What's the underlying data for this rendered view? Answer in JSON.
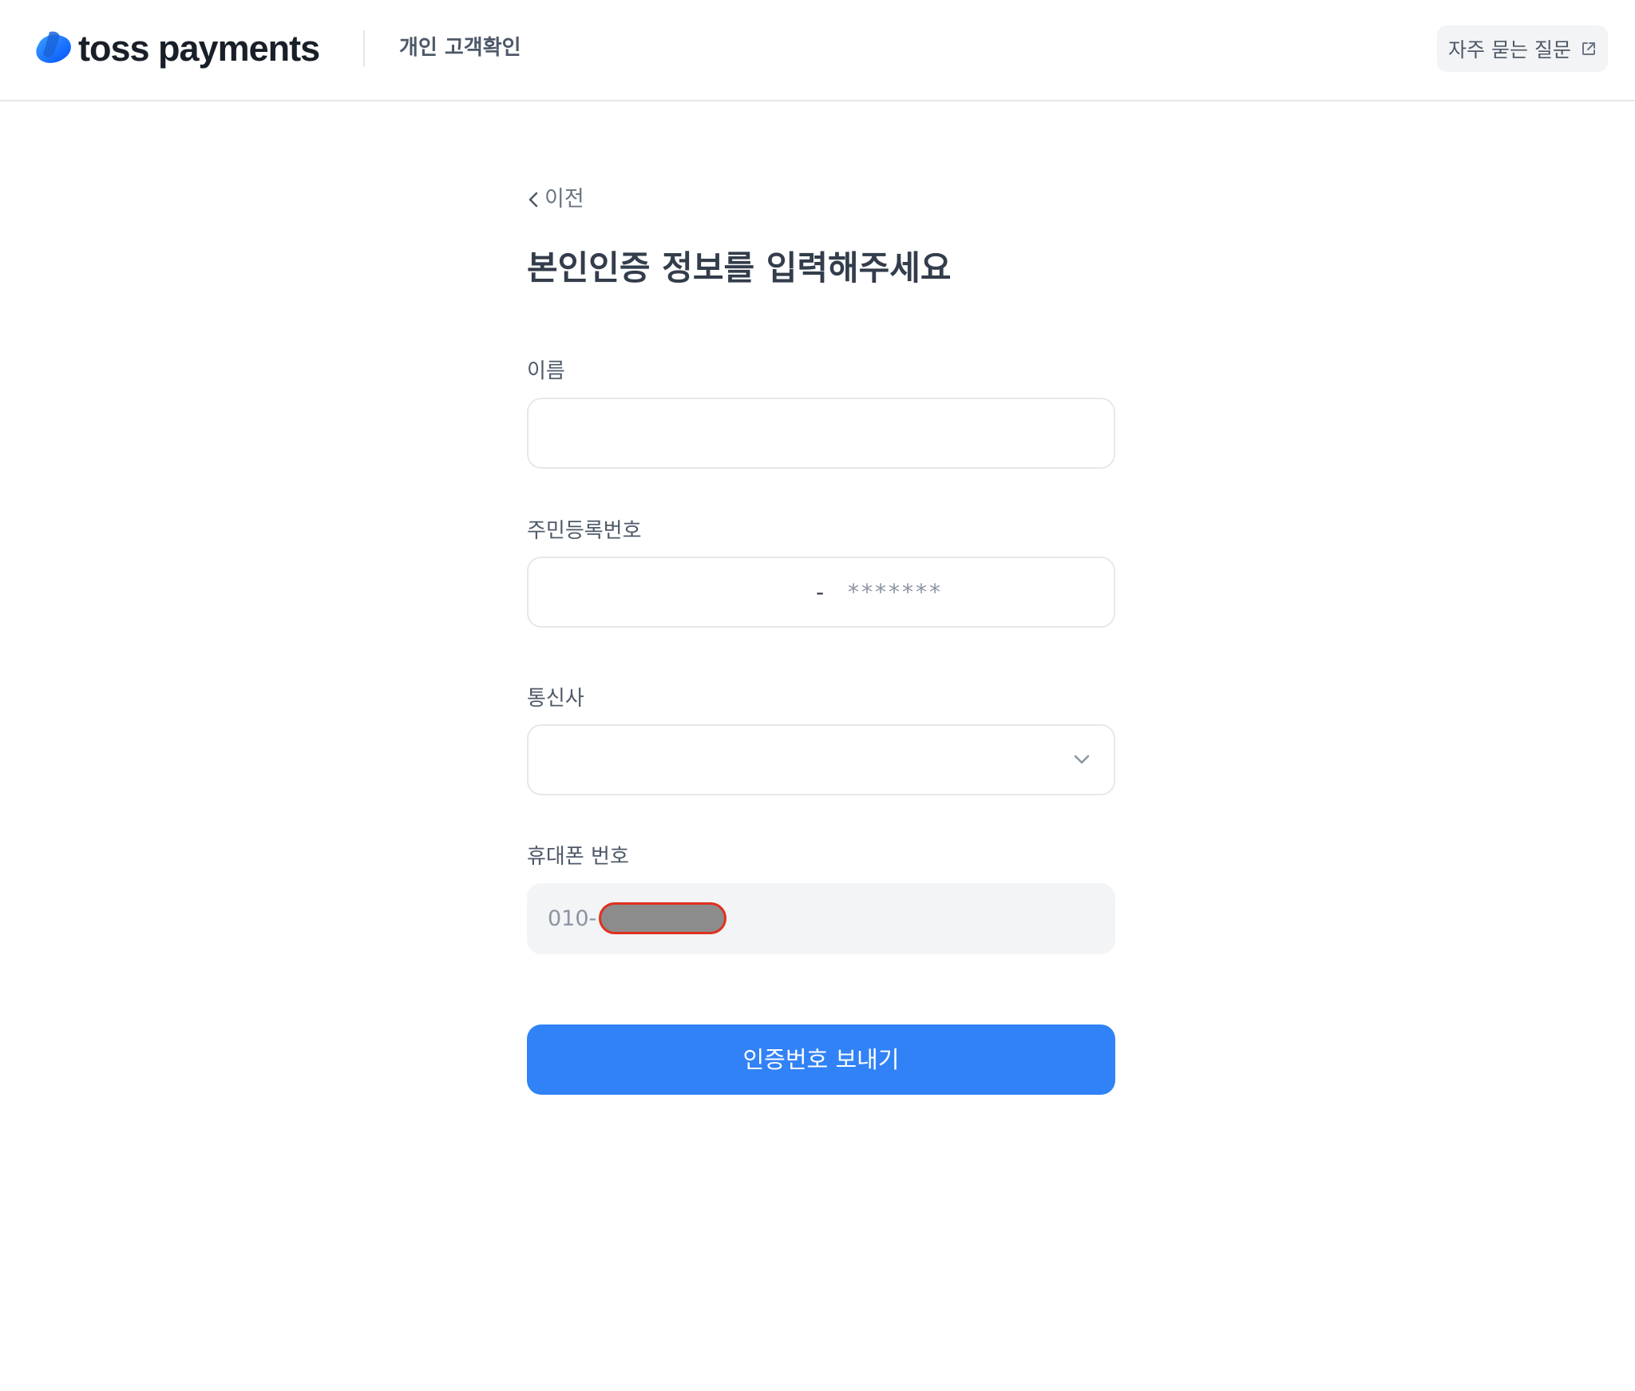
{
  "header": {
    "brand": "toss payments",
    "subtitle": "개인 고객확인",
    "faq_label": "자주 묻는 질문",
    "brand_color": "#3182f6"
  },
  "back": {
    "label": "이전"
  },
  "title": "본인인증 정보를 입력해주세요",
  "form": {
    "name": {
      "label": "이름",
      "value": ""
    },
    "rrn": {
      "label": "주민등록번호",
      "front_value": "",
      "separator": "-",
      "back_mask": "*******"
    },
    "carrier": {
      "label": "통신사",
      "selected": ""
    },
    "phone": {
      "label": "휴대폰 번호",
      "prefix": "010-"
    }
  },
  "submit": {
    "label": "인증번호 보내기",
    "color": "#3182f6"
  }
}
